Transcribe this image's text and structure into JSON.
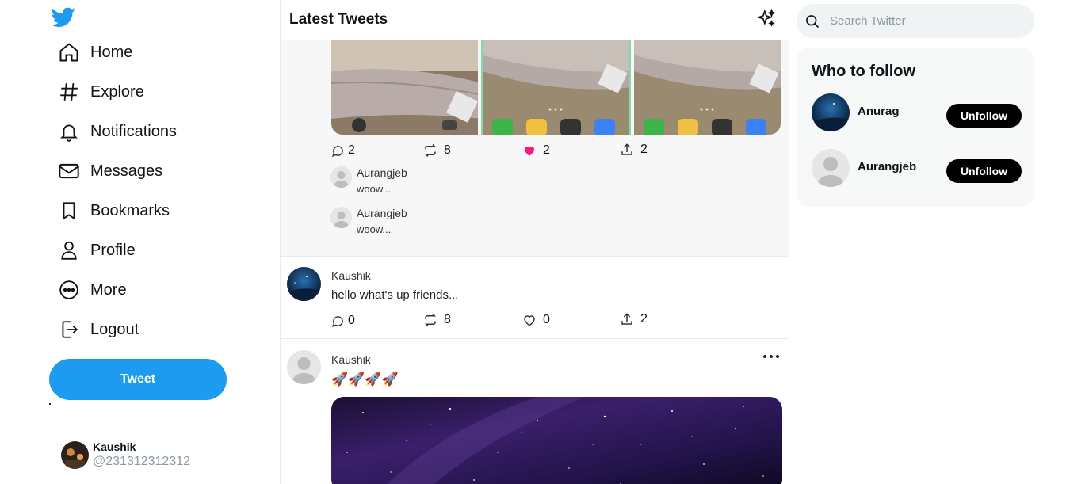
{
  "nav": {
    "items": [
      {
        "label": "Home",
        "icon": "home-icon"
      },
      {
        "label": "Explore",
        "icon": "hash-icon"
      },
      {
        "label": "Notifications",
        "icon": "bell-icon"
      },
      {
        "label": "Messages",
        "icon": "mail-icon"
      },
      {
        "label": "Bookmarks",
        "icon": "bookmark-icon"
      },
      {
        "label": "Profile",
        "icon": "user-icon"
      },
      {
        "label": "More",
        "icon": "more-circle-icon"
      },
      {
        "label": "Logout",
        "icon": "logout-icon"
      }
    ],
    "tweet_button": "Tweet"
  },
  "current_user": {
    "name": "Kaushik",
    "handle": "@231312312312"
  },
  "feed": {
    "title": "Latest Tweets",
    "posts": [
      {
        "stats": {
          "replies": "2",
          "retweets": "8",
          "likes": "2",
          "shares": "2"
        },
        "liked": true,
        "comments": [
          {
            "name": "Aurangjeb",
            "text": "woow..."
          },
          {
            "name": "Aurangjeb",
            "text": "woow..."
          }
        ]
      },
      {
        "name": "Kaushik",
        "text": "hello what's up friends...",
        "stats": {
          "replies": "0",
          "retweets": "8",
          "likes": "0",
          "shares": "2"
        }
      },
      {
        "name": "Kaushik",
        "text": "🚀🚀🚀🚀"
      }
    ]
  },
  "search": {
    "placeholder": "Search Twitter"
  },
  "who_to_follow": {
    "title": "Who to follow",
    "users": [
      {
        "name": "Anurag",
        "button": "Unfollow"
      },
      {
        "name": "Aurangjeb",
        "button": "Unfollow"
      }
    ]
  },
  "colors": {
    "accent": "#1d9bf0",
    "like": "#f91880"
  }
}
